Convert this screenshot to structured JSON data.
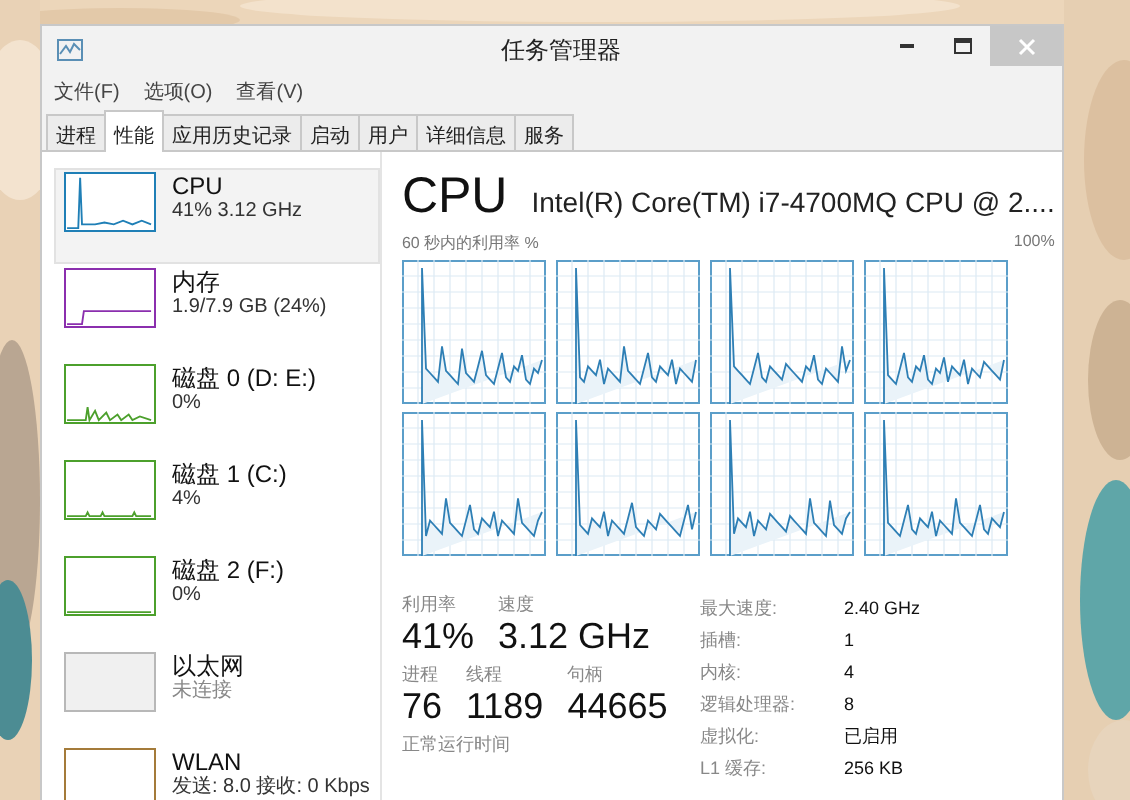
{
  "window": {
    "title": "任务管理器"
  },
  "menu": [
    "文件(F)",
    "选项(O)",
    "查看(V)"
  ],
  "tabs": [
    {
      "label": "进程",
      "selected": false
    },
    {
      "label": "性能",
      "selected": true
    },
    {
      "label": "应用历史记录",
      "selected": false
    },
    {
      "label": "启动",
      "selected": false
    },
    {
      "label": "用户",
      "selected": false
    },
    {
      "label": "详细信息",
      "selected": false
    },
    {
      "label": "服务",
      "selected": false
    }
  ],
  "sidebar": {
    "items": [
      {
        "kind": "cpu",
        "name": "CPU",
        "detail": "41% 3.12 GHz",
        "selected": true
      },
      {
        "kind": "memory",
        "name": "内存",
        "detail": "1.9/7.9 GB (24%)",
        "selected": false
      },
      {
        "kind": "disk",
        "name": "磁盘 0 (D: E:)",
        "detail": "0%",
        "selected": false
      },
      {
        "kind": "disk",
        "name": "磁盘 1 (C:)",
        "detail": "4%",
        "selected": false
      },
      {
        "kind": "disk",
        "name": "磁盘 2 (F:)",
        "detail": "0%",
        "selected": false
      },
      {
        "kind": "network",
        "name": "以太网",
        "detail": "未连接",
        "selected": false
      },
      {
        "kind": "wifi",
        "name": "WLAN",
        "detail": "发送: 8.0 接收: 0 Kbps",
        "selected": false
      }
    ]
  },
  "detail": {
    "title": "CPU",
    "model": "Intel(R) Core(TM) i7-4700MQ CPU @ 2....",
    "graph_caption": "60 秒内的利用率 %",
    "graph_max": "100%",
    "stats": [
      [
        {
          "label": "利用率",
          "value": "41%"
        },
        {
          "label": "速度",
          "value": "3.12 GHz"
        }
      ],
      [
        {
          "label": "进程",
          "value": "76"
        },
        {
          "label": "线程",
          "value": "1189"
        },
        {
          "label": "句柄",
          "value": "44665"
        }
      ]
    ],
    "uptime_label": "正常运行时间",
    "specs": [
      {
        "key": "最大速度:",
        "value": "2.40 GHz"
      },
      {
        "key": "插槽:",
        "value": "1"
      },
      {
        "key": "内核:",
        "value": "4"
      },
      {
        "key": "逻辑处理器:",
        "value": "8"
      },
      {
        "key": "虚拟化:",
        "value": "已启用"
      },
      {
        "key": "L1 缓存:",
        "value": "256 KB"
      }
    ]
  }
}
